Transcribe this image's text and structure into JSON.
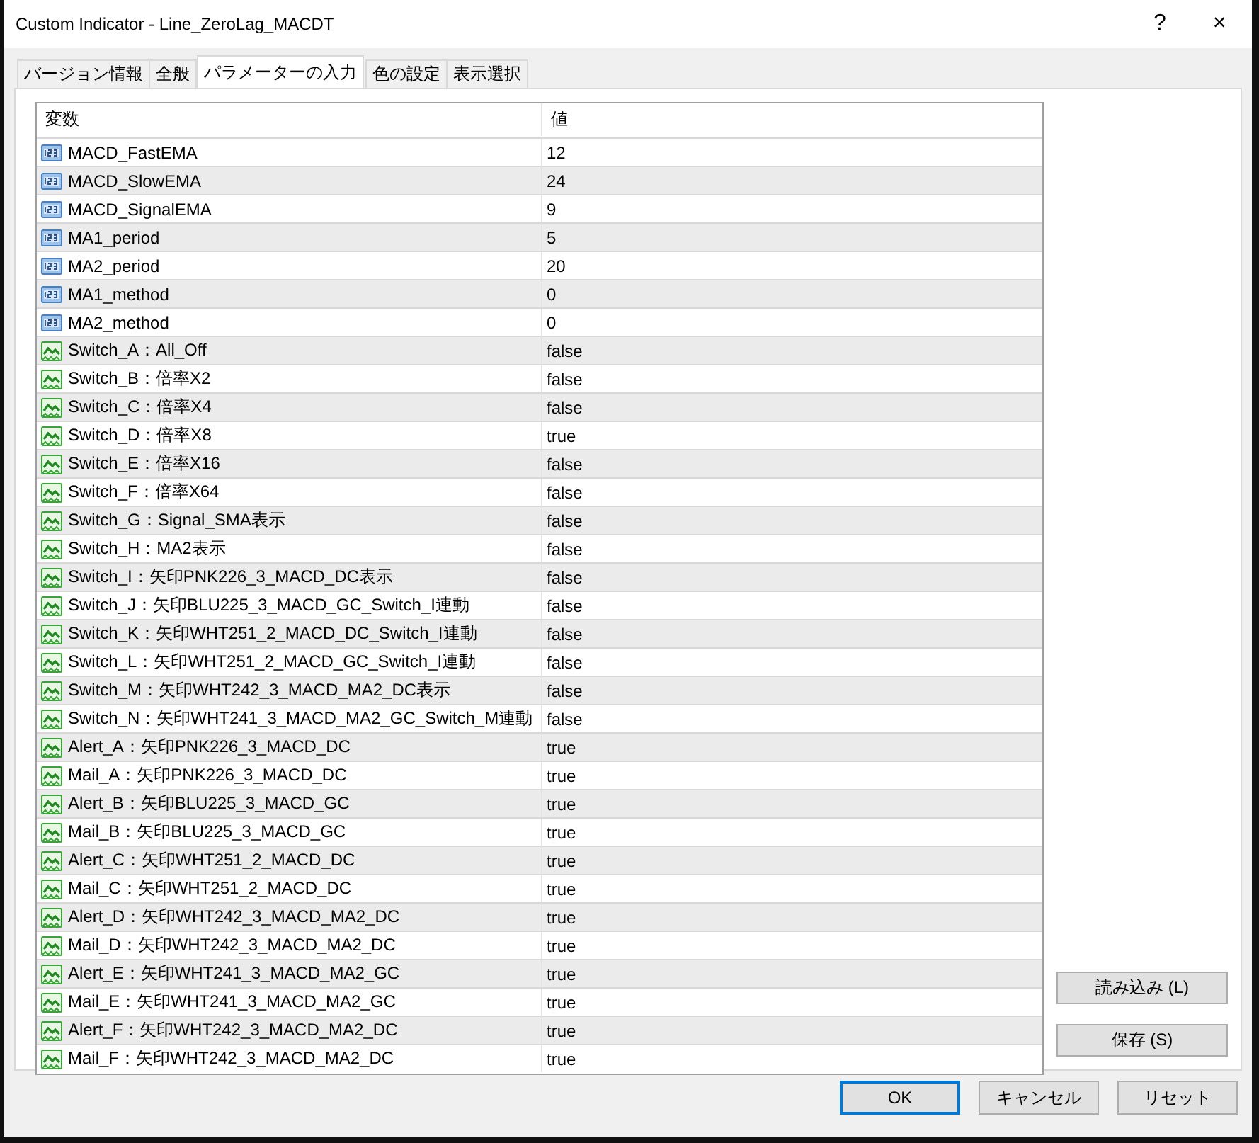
{
  "window": {
    "title": "Custom Indicator - Line_ZeroLag_MACDT",
    "help": "?",
    "close": "×"
  },
  "tabs": [
    {
      "label": "バージョン情報",
      "selected": false
    },
    {
      "label": "全般",
      "selected": false
    },
    {
      "label": "パラメーターの入力",
      "selected": true
    },
    {
      "label": "色の設定",
      "selected": false
    },
    {
      "label": "表示選択",
      "selected": false
    }
  ],
  "table": {
    "columns": [
      "変数",
      "値"
    ],
    "rows": [
      {
        "kind": "int",
        "name": "MACD_FastEMA",
        "value": "12"
      },
      {
        "kind": "int",
        "name": "MACD_SlowEMA",
        "value": "24"
      },
      {
        "kind": "int",
        "name": "MACD_SignalEMA",
        "value": "9"
      },
      {
        "kind": "int",
        "name": "MA1_period",
        "value": "5"
      },
      {
        "kind": "int",
        "name": "MA2_period",
        "value": "20"
      },
      {
        "kind": "int",
        "name": "MA1_method",
        "value": "0"
      },
      {
        "kind": "int",
        "name": "MA2_method",
        "value": "0"
      },
      {
        "kind": "bool",
        "name": "Switch_A：All_Off",
        "value": "false"
      },
      {
        "kind": "bool",
        "name": "Switch_B：倍率X2",
        "value": "false"
      },
      {
        "kind": "bool",
        "name": "Switch_C：倍率X4",
        "value": "false"
      },
      {
        "kind": "bool",
        "name": "Switch_D：倍率X8",
        "value": "true"
      },
      {
        "kind": "bool",
        "name": "Switch_E：倍率X16",
        "value": "false"
      },
      {
        "kind": "bool",
        "name": "Switch_F：倍率X64",
        "value": "false"
      },
      {
        "kind": "bool",
        "name": "Switch_G：Signal_SMA表示",
        "value": "false"
      },
      {
        "kind": "bool",
        "name": "Switch_H：MA2表示",
        "value": "false"
      },
      {
        "kind": "bool",
        "name": "Switch_I：矢印PNK226_3_MACD_DC表示",
        "value": "false"
      },
      {
        "kind": "bool",
        "name": "Switch_J：矢印BLU225_3_MACD_GC_Switch_I連動",
        "value": "false"
      },
      {
        "kind": "bool",
        "name": "Switch_K：矢印WHT251_2_MACD_DC_Switch_I連動",
        "value": "false"
      },
      {
        "kind": "bool",
        "name": "Switch_L：矢印WHT251_2_MACD_GC_Switch_I連動",
        "value": "false"
      },
      {
        "kind": "bool",
        "name": "Switch_M：矢印WHT242_3_MACD_MA2_DC表示",
        "value": "false"
      },
      {
        "kind": "bool",
        "name": "Switch_N：矢印WHT241_3_MACD_MA2_GC_Switch_M連動",
        "value": "false"
      },
      {
        "kind": "bool",
        "name": "Alert_A：矢印PNK226_3_MACD_DC",
        "value": "true"
      },
      {
        "kind": "bool",
        "name": "Mail_A：矢印PNK226_3_MACD_DC",
        "value": "true"
      },
      {
        "kind": "bool",
        "name": "Alert_B：矢印BLU225_3_MACD_GC",
        "value": "true"
      },
      {
        "kind": "bool",
        "name": "Mail_B：矢印BLU225_3_MACD_GC",
        "value": "true"
      },
      {
        "kind": "bool",
        "name": "Alert_C：矢印WHT251_2_MACD_DC",
        "value": "true"
      },
      {
        "kind": "bool",
        "name": "Mail_C：矢印WHT251_2_MACD_DC",
        "value": "true"
      },
      {
        "kind": "bool",
        "name": "Alert_D：矢印WHT242_3_MACD_MA2_DC",
        "value": "true"
      },
      {
        "kind": "bool",
        "name": "Mail_D：矢印WHT242_3_MACD_MA2_DC",
        "value": "true"
      },
      {
        "kind": "bool",
        "name": "Alert_E：矢印WHT241_3_MACD_MA2_GC",
        "value": "true"
      },
      {
        "kind": "bool",
        "name": "Mail_E：矢印WHT241_3_MACD_MA2_GC",
        "value": "true"
      },
      {
        "kind": "bool",
        "name": "Alert_F：矢印WHT242_3_MACD_MA2_DC",
        "value": "true"
      },
      {
        "kind": "bool",
        "name": "Mail_F：矢印WHT242_3_MACD_MA2_DC",
        "value": "true"
      }
    ]
  },
  "side_buttons": [
    "読み込み (L)",
    "保存 (S)"
  ],
  "buttons": [
    {
      "label": "OK",
      "default": true
    },
    {
      "label": "キャンセル",
      "default": false
    },
    {
      "label": "リセット",
      "default": false
    }
  ]
}
